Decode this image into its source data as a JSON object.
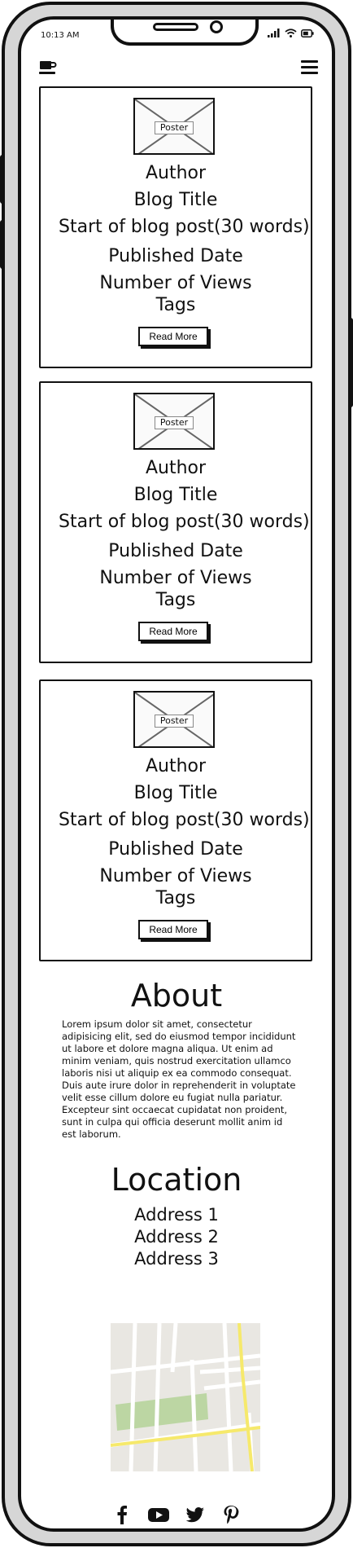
{
  "status_bar": {
    "time": "10:13 AM",
    "signal_icon": "signal-icon",
    "wifi_icon": "wifi-icon",
    "battery_icon": "battery-icon"
  },
  "header": {
    "logo_icon": "coffee-cup-icon",
    "menu_icon": "hamburger-menu-icon"
  },
  "posts": [
    {
      "poster_label": "Poster",
      "author": "Author",
      "title": "Blog Title",
      "excerpt": "Start of blog post(30 words)",
      "published": "Published Date",
      "views": "Number of Views",
      "tags": "Tags",
      "read_more": "Read More"
    },
    {
      "poster_label": "Poster",
      "author": "Author",
      "title": "Blog Title",
      "excerpt": "Start of blog post(30 words)",
      "published": "Published Date",
      "views": "Number of Views",
      "tags": "Tags",
      "read_more": "Read More"
    },
    {
      "poster_label": "Poster",
      "author": "Author",
      "title": "Blog Title",
      "excerpt": "Start of blog post(30 words)",
      "published": "Published Date",
      "views": "Number of Views",
      "tags": "Tags",
      "read_more": "Read More"
    }
  ],
  "about": {
    "title": "About",
    "text": "Lorem ipsum dolor sit amet, consectetur adipisicing elit, sed do eiusmod tempor incididunt ut labore et dolore magna aliqua. Ut enim ad minim veniam, quis nostrud exercitation ullamco laboris nisi ut aliquip ex ea commodo consequat. Duis aute irure dolor in reprehenderit in voluptate velit esse cillum dolore eu fugiat nulla pariatur. Excepteur sint occaecat cupidatat non proident, sunt in culpa qui officia deserunt mollit anim id est laborum."
  },
  "location": {
    "title": "Location",
    "addresses": [
      "Address 1",
      "Address 2",
      "Address 3"
    ]
  },
  "map": {
    "icon": "map-icon",
    "road_color": "#ffffff",
    "highlight_road_color": "#f6e96b",
    "park_color": "#bcd6a3",
    "land_color": "#e9e7e2"
  },
  "social": {
    "facebook_icon": "facebook-icon",
    "youtube_icon": "youtube-icon",
    "twitter_icon": "twitter-icon",
    "pinterest_icon": "pinterest-icon"
  }
}
